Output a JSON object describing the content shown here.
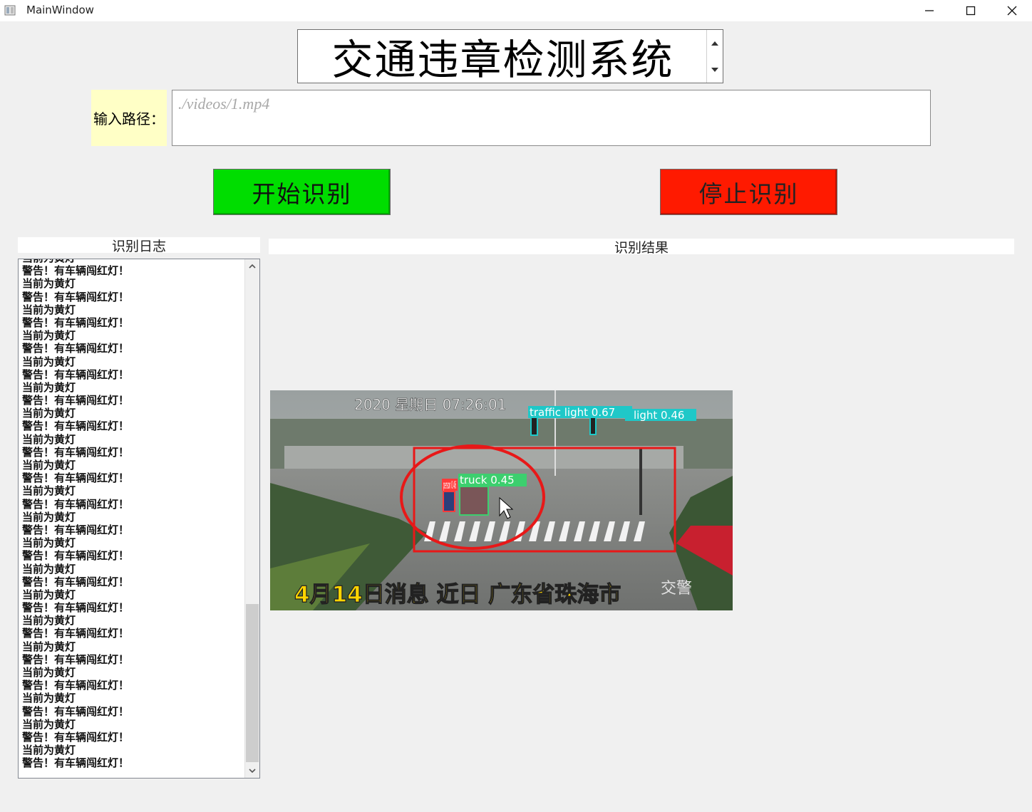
{
  "window": {
    "title": "MainWindow",
    "controls": {
      "minimize": "minimize-icon",
      "maximize": "maximize-icon",
      "close": "close-icon"
    }
  },
  "header": {
    "title": "交通违章检测系统"
  },
  "path": {
    "label": "输入路径：",
    "placeholder": "./videos/1.mp4",
    "value": ""
  },
  "buttons": {
    "start": "开始识别",
    "stop": "停止识别"
  },
  "colors": {
    "start": "#00dd00",
    "stop": "#ff1a00",
    "path_label_bg": "#ffffc6"
  },
  "log": {
    "title": "识别日志",
    "lines": [
      "当前为黄灯",
      "警告！有车辆闯红灯！",
      "当前为黄灯",
      "警告！有车辆闯红灯！",
      "当前为黄灯",
      "警告！有车辆闯红灯！",
      "当前为黄灯",
      "警告！有车辆闯红灯！",
      "当前为黄灯",
      "警告！有车辆闯红灯！",
      "当前为黄灯",
      "警告！有车辆闯红灯！",
      "当前为黄灯",
      "警告！有车辆闯红灯！",
      "当前为黄灯",
      "警告！有车辆闯红灯！",
      "当前为黄灯",
      "警告！有车辆闯红灯！",
      "当前为黄灯",
      "警告！有车辆闯红灯！",
      "当前为黄灯",
      "警告！有车辆闯红灯！",
      "当前为黄灯",
      "警告！有车辆闯红灯！",
      "当前为黄灯",
      "警告！有车辆闯红灯！",
      "当前为黄灯",
      "警告！有车辆闯红灯！",
      "当前为黄灯",
      "警告！有车辆闯红灯！",
      "当前为黄灯",
      "警告！有车辆闯红灯！",
      "当前为黄灯",
      "警告！有车辆闯红灯！",
      "当前为黄灯",
      "警告！有车辆闯红灯！",
      "当前为黄灯",
      "警告！有车辆闯红灯！",
      "当前为黄灯",
      "警告！有车辆闯红灯！"
    ]
  },
  "result": {
    "title": "识别结果",
    "frame": {
      "timestamp": "2020  星期日  07:26:01",
      "caption": "4月14日消息 近日 广东省珠海市",
      "watermark": "交警",
      "detections": [
        {
          "label": "traffic light 0.67",
          "color": "#1fc8c8"
        },
        {
          "label": "light 0.46",
          "color": "#1fc8c8"
        },
        {
          "label": "truck 0.45",
          "color": "#3ccf6e"
        },
        {
          "label": "person 0.46",
          "color": "#ff3a3a"
        }
      ],
      "violation_zone_color": "#e81818"
    }
  }
}
